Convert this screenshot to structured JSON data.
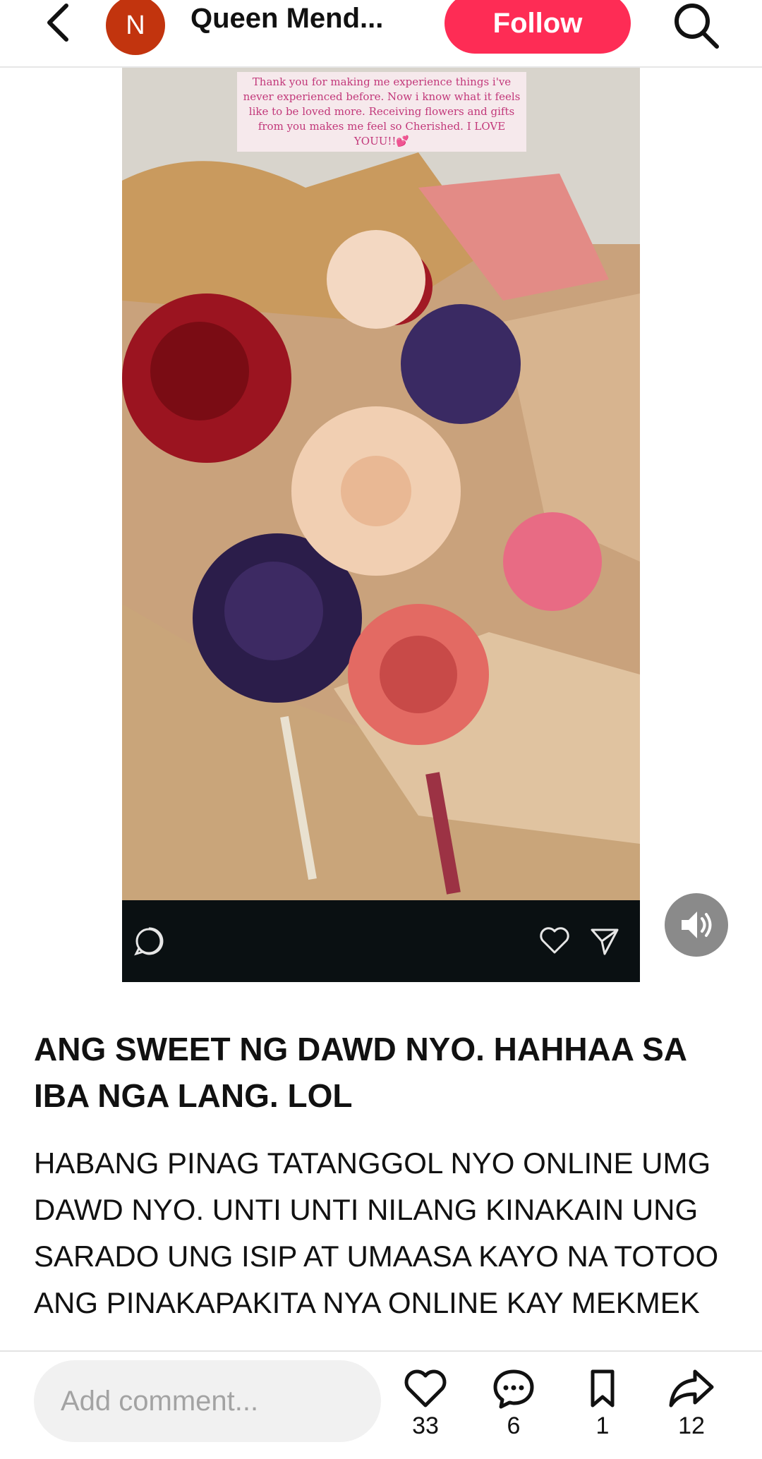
{
  "header": {
    "avatar_initial": "N",
    "username": "Queen Mend...",
    "follow_label": "Follow"
  },
  "media": {
    "overlay_text": "Thank you for making me experience things i've never experienced before. Now i know what it feels like to be loved more. Receiving flowers and gifts from you makes me feel so Cherished. I LOVE YOUU!!💕"
  },
  "post": {
    "title": "ANG SWEET NG DAWD NYO. HAHHAA SA IBA NGA LANG. LOL",
    "body": "HABANG PINAG TATANGGOL NYO ONLINE UMG DAWD NYO. UNTI UNTI NILANG KINAKAIN UNG SARADO UNG ISIP AT UMAASA KAYO NA TOTOO ANG PINAKAPAKITA NYA ONLINE KAY MEKMEK"
  },
  "bottom_bar": {
    "comment_placeholder": "Add comment...",
    "likes": "33",
    "comments": "6",
    "saves": "1",
    "shares": "12"
  },
  "colors": {
    "accent": "#fe2c55",
    "avatar": "#c2340e"
  },
  "icons": {
    "back": "chevron-left-icon",
    "search": "search-icon",
    "sound": "speaker-icon",
    "like": "heart-icon",
    "comment": "comment-bubble-icon",
    "save": "bookmark-icon",
    "share": "share-arrow-icon"
  }
}
